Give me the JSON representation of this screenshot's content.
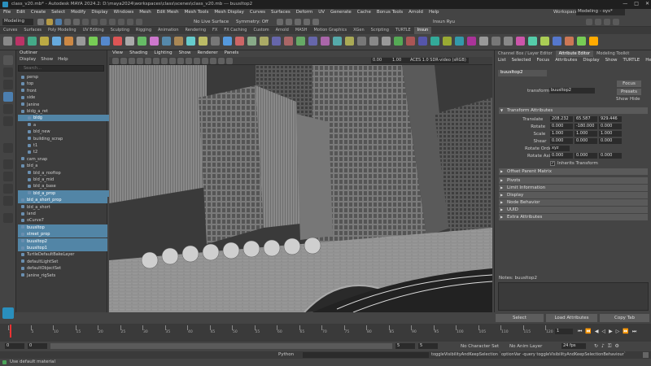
{
  "window": {
    "title": "class_v20.mb* - Autodesk MAYA 2024.2: D:\\maya2024\\workspaces\\class\\scenes\\class_v20.mb  ---  buusItop2",
    "minimize": "—",
    "maximize": "□",
    "close": "✕"
  },
  "menubar": [
    "File",
    "Edit",
    "Create",
    "Select",
    "Modify",
    "Display",
    "Windows",
    "Mesh",
    "Edit Mesh",
    "Mesh Tools",
    "Mesh Display",
    "Curves",
    "Surfaces",
    "Deform",
    "UV",
    "Generate",
    "Cache",
    "Bonus Tools",
    "Arnold",
    "Help"
  ],
  "workspace": {
    "label": "Workspace:",
    "value": "Modeling - oys*"
  },
  "statusline": {
    "mode": "Modeling",
    "no_live_surface": "No Live Surface",
    "symmetry": "Symmetry: Off",
    "user": "Insun Ryu"
  },
  "shelf_tabs": [
    "Curves",
    "Surfaces",
    "Poly Modeling",
    "UV Editing",
    "Sculpting",
    "Rigging",
    "Animation",
    "Rendering",
    "FX",
    "FX Caching",
    "Custom",
    "Arnold",
    "MASH",
    "Motion Graphics",
    "XGen",
    "Scripting",
    "TURTLE",
    "Insun"
  ],
  "shelf_active": "Insun",
  "outliner": {
    "title": "Outliner",
    "menu": [
      "Display",
      "Show",
      "Help"
    ],
    "search_placeholder": "Search...",
    "items": [
      {
        "name": "persp",
        "selected": false,
        "indent": 0
      },
      {
        "name": "top",
        "selected": false,
        "indent": 0
      },
      {
        "name": "front",
        "selected": false,
        "indent": 0
      },
      {
        "name": "side",
        "selected": false,
        "indent": 0
      },
      {
        "name": "Janine",
        "selected": false,
        "indent": 0
      },
      {
        "name": "bldg_a_ret",
        "selected": false,
        "indent": 0
      },
      {
        "name": "bldg",
        "selected": true,
        "indent": 1
      },
      {
        "name": "a",
        "selected": false,
        "indent": 1
      },
      {
        "name": "bld_new",
        "selected": false,
        "indent": 1
      },
      {
        "name": "building_scrap",
        "selected": false,
        "indent": 1
      },
      {
        "name": "t1",
        "selected": false,
        "indent": 1
      },
      {
        "name": "t2",
        "selected": false,
        "indent": 1
      },
      {
        "name": "cam_snap",
        "selected": false,
        "indent": 0
      },
      {
        "name": "bld_a",
        "selected": false,
        "indent": 0
      },
      {
        "name": "bld_a_rooftop",
        "selected": false,
        "indent": 1
      },
      {
        "name": "bld_a_mid",
        "selected": false,
        "indent": 1
      },
      {
        "name": "bld_a_base",
        "selected": false,
        "indent": 1
      },
      {
        "name": "bld_a_prop",
        "selected": true,
        "indent": 1
      },
      {
        "name": "bld_a_short_prop",
        "selected": true,
        "indent": 0
      },
      {
        "name": "bld_a_short",
        "selected": false,
        "indent": 0
      },
      {
        "name": "land",
        "selected": false,
        "indent": 0
      },
      {
        "name": "oCurve7",
        "selected": false,
        "indent": 0
      },
      {
        "name": "buusItop",
        "selected": true,
        "indent": 0
      },
      {
        "name": "street_prop",
        "selected": true,
        "indent": 0
      },
      {
        "name": "buusItop2",
        "selected": true,
        "indent": 0
      },
      {
        "name": "buusItop1",
        "selected": true,
        "indent": 0
      },
      {
        "name": "TurtleDefaultBakeLayer",
        "selected": false,
        "indent": 0
      },
      {
        "name": "defaultLightSet",
        "selected": false,
        "indent": 0
      },
      {
        "name": "defaultObjectSet",
        "selected": false,
        "indent": 0
      },
      {
        "name": "Janine_rigSets",
        "selected": false,
        "indent": 0
      }
    ]
  },
  "viewport": {
    "menu": [
      "View",
      "Shading",
      "Lighting",
      "Show",
      "Renderer",
      "Panels"
    ],
    "field_a": "0.00",
    "field_b": "1.00",
    "colorspace": "ACES 1.0 SDR-video (sRGB)"
  },
  "attribute_editor": {
    "tabs": [
      "Channel Box / Layer Editor",
      "Attribute Editor",
      "Modeling Toolkit"
    ],
    "active_tab": "Attribute Editor",
    "menu": [
      "List",
      "Selected",
      "Focus",
      "Attributes",
      "Display",
      "Show",
      "TURTLE",
      "Help"
    ],
    "node_tab": "buusItop2",
    "transform_label": "transform:",
    "transform_value": "buusItop2",
    "focus": "Focus",
    "presets": "Presets",
    "show": "Show",
    "hide": "Hide",
    "section_transform": "Transform Attributes",
    "rows": [
      {
        "label": "Translate",
        "values": [
          "208.232",
          "65.587",
          "929.446"
        ]
      },
      {
        "label": "Rotate",
        "values": [
          "0.000",
          "-180.000",
          "0.000"
        ]
      },
      {
        "label": "Scale",
        "values": [
          "1.000",
          "1.000",
          "1.000"
        ]
      },
      {
        "label": "Shear",
        "values": [
          "0.000",
          "0.000",
          "0.000"
        ]
      }
    ],
    "rotate_order_label": "Rotate Order",
    "rotate_order": "xyz",
    "rotate_axis_label": "Rotate Axis",
    "rotate_axis": [
      "0.000",
      "0.000",
      "0.000"
    ],
    "inherits": "Inherits Transform",
    "offset_parent": "Offset Parent Matrix",
    "sections": [
      "Pivots",
      "Limit Information",
      "Display",
      "Node Behavior",
      "UUID",
      "Extra Attributes"
    ],
    "notes": "Notes:  buusItop2",
    "buttons": [
      "Select",
      "Load Attributes",
      "Copy Tab"
    ]
  },
  "timeline": {
    "ticks": [
      "1",
      "5",
      "10",
      "15",
      "20",
      "25",
      "30",
      "35",
      "40",
      "45",
      "50",
      "55",
      "60",
      "65",
      "70",
      "75",
      "80",
      "85",
      "90",
      "95",
      "100",
      "105",
      "110",
      "115",
      "120"
    ],
    "current": "1"
  },
  "range": {
    "start": "0",
    "start2": "0",
    "end": "5",
    "end2": "5",
    "character_set": "No Character Set",
    "anim_layer": "No Anim Layer",
    "fps": "24 fps"
  },
  "cmdline": {
    "lang": "Python",
    "output": "toggleVisibilityAndKeepSelection `optionVar -query toggleVisibilityAndKeepSelectionBehaviour`"
  },
  "helpline": "Use default material"
}
